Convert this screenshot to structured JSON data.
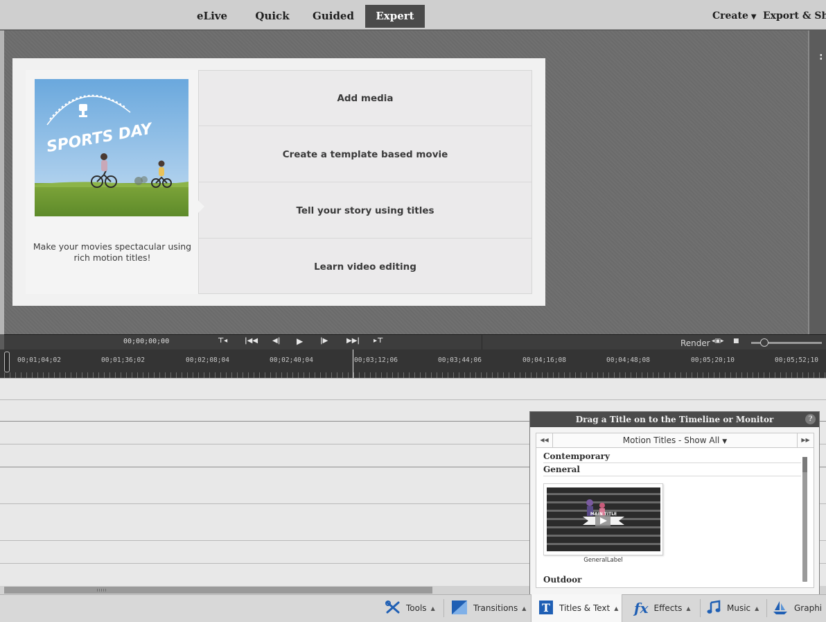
{
  "top_nav": {
    "tabs": [
      {
        "label": "eLive"
      },
      {
        "label": "Quick"
      },
      {
        "label": "Guided"
      },
      {
        "label": "Expert",
        "active": true
      }
    ],
    "create_label": "Create",
    "export_label": "Export & Sha"
  },
  "welcome": {
    "hero_text": "SPORTS DAY",
    "description": "Make your movies spectacular using rich motion titles!",
    "options": [
      {
        "label": "Add media"
      },
      {
        "label": "Create a template based movie"
      },
      {
        "label": "Tell your story using titles"
      },
      {
        "label": "Learn video editing"
      }
    ]
  },
  "transport": {
    "timecode": "00;00;00;00",
    "render_label": "Render"
  },
  "ruler": {
    "labels": [
      "00;01;04;02",
      "00;01;36;02",
      "00;02;08;04",
      "00;02;40;04",
      "00;03;12;06",
      "00;03;44;06",
      "00;04;16;08",
      "00;04;48;08",
      "00;05;20;10",
      "00;05;52;10"
    ]
  },
  "titles_panel": {
    "header": "Drag a Title on to the Timeline or Monitor",
    "category_select": "Motion Titles - Show All",
    "sections": [
      "Contemporary",
      "General",
      "Outdoor"
    ],
    "thumbnail_label": "GeneralLabel",
    "thumbnail_overlay_text": "MAIN TITLE"
  },
  "bottom_toolbar": {
    "items": [
      {
        "label": "Tools",
        "icon": "tools-icon"
      },
      {
        "label": "Transitions",
        "icon": "transitions-icon"
      },
      {
        "label": "Titles & Text",
        "icon": "titles-text-icon",
        "active": true
      },
      {
        "label": "Effects",
        "icon": "effects-icon"
      },
      {
        "label": "Music",
        "icon": "music-icon"
      },
      {
        "label": "Graphi",
        "icon": "graphics-icon"
      }
    ]
  },
  "colors": {
    "active_tab_bg": "#4a4a4a",
    "monitor_bg": "#6b6b6b",
    "timeline_bg": "#343434",
    "accent_blue": "#1f5fb4"
  }
}
